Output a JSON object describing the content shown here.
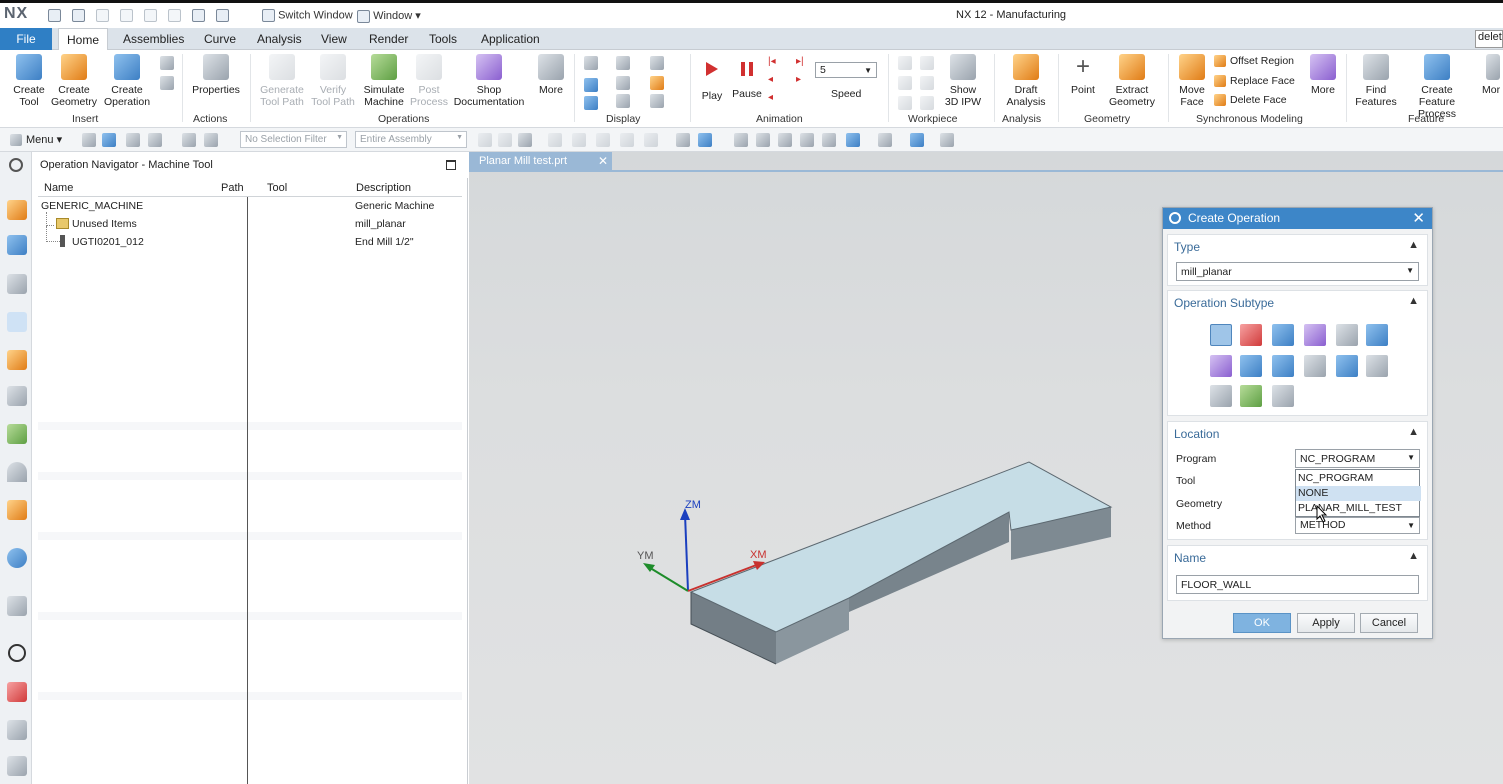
{
  "app": {
    "logo": "NX",
    "window_title": "NX 12 - Manufacturing",
    "switch_window": "Switch Window",
    "window_menu": "Window ▾"
  },
  "tabs": [
    "File",
    "Home",
    "Assemblies",
    "Curve",
    "Analysis",
    "View",
    "Render",
    "Tools",
    "Application"
  ],
  "search_value": "delete",
  "ribbon": {
    "insert": {
      "create_tool": "Create Tool",
      "create_geometry": "Create Geometry",
      "create_operation": "Create Operation",
      "group": "Insert"
    },
    "actions": {
      "properties": "Properties",
      "group": "Actions"
    },
    "operations": {
      "generate_tool_path": "Generate Tool Path",
      "verify_tool_path": "Verify Tool Path",
      "simulate_machine": "Simulate Machine",
      "post_process": "Post Process",
      "shop_documentation": "Shop Documentation",
      "more": "More",
      "group": "Operations"
    },
    "display": {
      "group": "Display"
    },
    "animation": {
      "play": "Play",
      "pause": "Pause",
      "speed_value": "5",
      "speed": "Speed",
      "group": "Animation"
    },
    "workpiece": {
      "show_3d_ipw": "Show 3D IPW",
      "group": "Workpiece"
    },
    "analysis": {
      "draft_analysis": "Draft Analysis",
      "group": "Analysis"
    },
    "geometry": {
      "point": "Point",
      "extract_geometry": "Extract Geometry",
      "group": "Geometry"
    },
    "synchronous": {
      "move_face": "Move Face",
      "offset_region": "Offset Region",
      "replace_face": "Replace Face",
      "delete_face": "Delete Face",
      "more": "More",
      "group": "Synchronous Modeling"
    },
    "feature": {
      "find_features": "Find Features",
      "create_feature_process": "Create Feature Process",
      "more": "Mor",
      "group": "Feature"
    }
  },
  "selection_bar": {
    "menu": "Menu ▾",
    "filter": "No Selection Filter",
    "scope": "Entire Assembly"
  },
  "navigator": {
    "title": "Operation Navigator - Machine Tool",
    "columns": [
      "Name",
      "Path",
      "Tool",
      "Description"
    ],
    "rows": [
      {
        "name": "GENERIC_MACHINE",
        "description": "Generic Machine"
      },
      {
        "name": "Unused Items",
        "description": "mill_planar"
      },
      {
        "name": "UGTI0201_012",
        "description": "End Mill 1/2\""
      }
    ]
  },
  "graphics": {
    "tab": "Planar Mill test.prt",
    "axes": {
      "z": "ZM",
      "y": "YM",
      "x": "XM"
    }
  },
  "dialog": {
    "title": "Create Operation",
    "type_header": "Type",
    "type_value": "mill_planar",
    "subtype_header": "Operation Subtype",
    "location_header": "Location",
    "program_label": "Program",
    "program_value": "NC_PROGRAM",
    "program_options": [
      "NC_PROGRAM",
      "NONE",
      "PLANAR_MILL_TEST"
    ],
    "tool_label": "Tool",
    "geometry_label": "Geometry",
    "method_label": "Method",
    "method_value": "METHOD",
    "name_header": "Name",
    "name_value": "FLOOR_WALL",
    "ok": "OK",
    "apply": "Apply",
    "cancel": "Cancel"
  },
  "colors": {
    "accent": "#3d86c8",
    "file_tab": "#2f7fc5",
    "part_top": "#c4dde6",
    "part_side": "#7d8a93"
  }
}
